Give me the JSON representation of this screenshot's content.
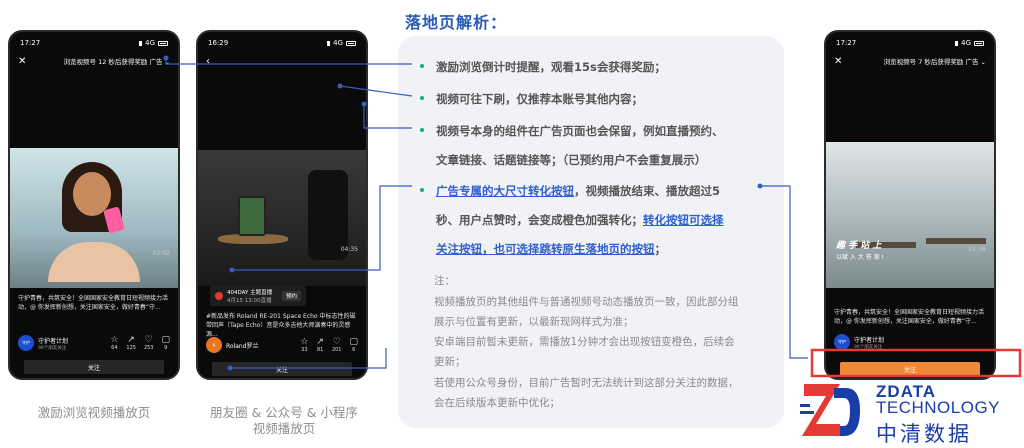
{
  "heading": "落地页解析：",
  "phones": {
    "p1": {
      "time": "17:27",
      "net": "4G",
      "title": "浏览视频号 12 秒后获得奖励",
      "ad": "广告",
      "duration": "02:02",
      "caption": "守护青春，共筑安全！全国国家安全教育日短视频接力活动，@ 你发挥新创想，关注国家安全，做好青春“守...",
      "account": "守护者计划",
      "account_sub": "96个朋友关注",
      "actions": [
        "64",
        "125",
        "253",
        "9"
      ],
      "follow": "关注"
    },
    "p2": {
      "time": "16:29",
      "net": "4G",
      "duration": "04:35",
      "live_title": "404DAY 主题直播",
      "live_sub": "4月15 13:00直播",
      "live_btn": "预约",
      "caption": "#新品发布 Roland RE-201 Space Echo 中标志性的磁带回声（Tape Echo）音是众多吉他大师演奏中的灵感源...",
      "account": "Roland罗兰",
      "actions": [
        "33",
        "81",
        "201",
        "6"
      ],
      "follow": "关注"
    },
    "p3": {
      "time": "17:27",
      "net": "4G",
      "title": "浏览视频号 7 秒后获得奖励",
      "ad": "广告",
      "overlay_title": "趣 手 站 上",
      "overlay_sub": "以赋 入 大 答 案 !",
      "duration": "01:58",
      "caption": "守护青春，共筑安全！全国国家安全教育日短视频接力活动，@ 你发挥新创想，关注国家安全，做好青春“守...",
      "account": "守护者计划",
      "account_sub": "96个朋友关注",
      "actions": [
        "64",
        "125",
        "253",
        "9"
      ],
      "follow": "关注"
    }
  },
  "labels": {
    "l1": "激励浏览视频播放页",
    "l2a": "朋友圈 & 公众号 & 小程序",
    "l2b": "视频播放页"
  },
  "points": [
    "激励浏览倒计时提醒，观看15s会获得奖励；",
    "视频可往下刷，仅推荐本账号其他内容；",
    "视频号本身的组件在广告页面也会保留，例如直播预约、",
    "文章链接、话题链接等；（已预约用户不会重复展示）"
  ],
  "point4": {
    "a_hl": "广告专属的大尺寸转化按钮",
    "a_rest": "，视频播放结束、播放超过5",
    "b_plain": "秒、用户点赞时，会变成橙色加强转化；",
    "b_hl": "转化按钮可选择",
    "c_hl": "关注按钮，也可选择跳转原生落地页的按钮",
    "c_rest": "；"
  },
  "notes": [
    "注：",
    "视频播放页的其他组件与普通视频号动态播放页一致，因此部分组",
    "展示与位置有更新，以最新现网样式为准；",
    "安卓端目前暂未更新，需播放1分钟才会出现按钮变橙色，后续会",
    "更新；",
    "若使用公众号身份，目前广告暂时无法统计到这部分关注的数据，",
    "会在后续版本更新中优化；"
  ],
  "logo": {
    "en1": "ZDATA",
    "en2": "TECHNOLOGY",
    "cn": "中清数据"
  },
  "colors": {
    "accent": "#2a5bb7",
    "green_dot": "#19a974",
    "orange": "#f0883a",
    "red_box": "#e53935",
    "connector": "#3a5ec0"
  }
}
